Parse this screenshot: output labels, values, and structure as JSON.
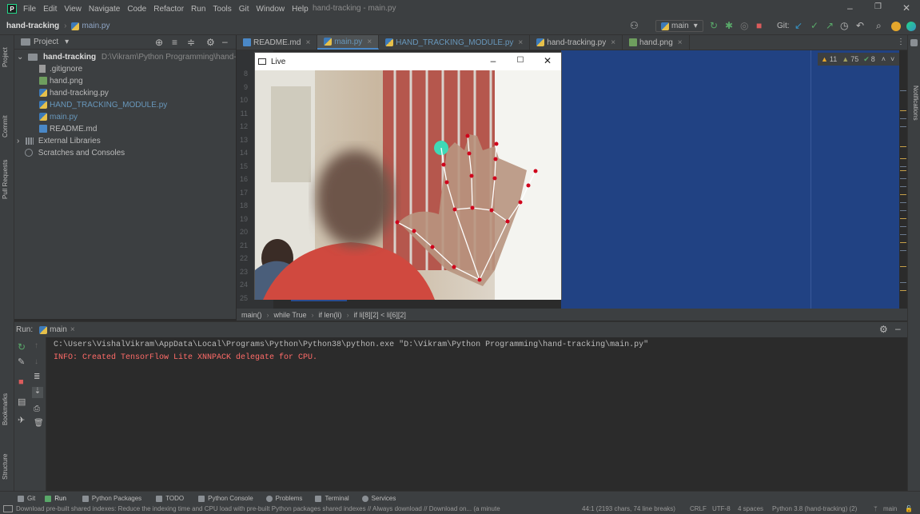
{
  "window": {
    "title": "hand-tracking - main.py"
  },
  "menu": [
    "File",
    "Edit",
    "View",
    "Navigate",
    "Code",
    "Refactor",
    "Run",
    "Tools",
    "Git",
    "Window",
    "Help"
  ],
  "navbar": {
    "project": "hand-tracking",
    "file": "main.py",
    "branch": "main",
    "git_label": "Git:"
  },
  "project_panel": {
    "title": "Project",
    "root": "hand-tracking",
    "root_path": "D:\\Vikram\\Python Programming\\hand-tracking",
    "files": [
      ".gitignore",
      "hand.png",
      "hand-tracking.py",
      "HAND_TRACKING_MODULE.py",
      "main.py",
      "README.md"
    ],
    "external": "External Libraries",
    "scratches": "Scratches and Consoles"
  },
  "side_tools": {
    "project": "Project",
    "commit": "Commit",
    "pull_requests": "Pull Requests",
    "bookmarks": "Bookmarks",
    "structure": "Structure",
    "notifications": "Notifications"
  },
  "tabs": [
    {
      "label": "README.md",
      "icon": "md"
    },
    {
      "label": "main.py",
      "icon": "py"
    },
    {
      "label": "HAND_TRACKING_MODULE.py",
      "icon": "py"
    },
    {
      "label": "hand-tracking.py",
      "icon": "py"
    },
    {
      "label": "hand.png",
      "icon": "png"
    }
  ],
  "line_numbers": [
    "8",
    "9",
    "10",
    "11",
    "12",
    "13",
    "14",
    "15",
    "16",
    "17",
    "18",
    "19",
    "20",
    "21",
    "22",
    "23",
    "24",
    "25"
  ],
  "inspections": {
    "warnings": "11",
    "weak": "75",
    "ok": "8"
  },
  "breadcrumbs": [
    "main()",
    "while True",
    "if len(li)",
    "if li[8][2] < li[6][2]"
  ],
  "run": {
    "label": "Run:",
    "config": "main"
  },
  "console": {
    "line1": "C:\\Users\\VishalVikram\\AppData\\Local\\Programs\\Python\\Python38\\python.exe \"D:\\Vikram\\Python Programming\\hand-tracking\\main.py\"",
    "line2": "INFO: Created TensorFlow Lite XNNPACK delegate for CPU."
  },
  "bottom_tools": [
    "Git",
    "Run",
    "Python Packages",
    "TODO",
    "Python Console",
    "Problems",
    "Terminal",
    "Services"
  ],
  "status": {
    "message": "Download pre-built shared indexes: Reduce the indexing time and CPU load with pre-built Python packages shared indexes // Always download // Download on... (a minute",
    "position": "44:1 (2193 chars, 74 line breaks)",
    "line_sep": "CRLF",
    "encoding": "UTF-8",
    "indent": "4 spaces",
    "interpreter": "Python 3.8 (hand-tracking) (2)",
    "branch": "main"
  },
  "live": {
    "title": "Live"
  },
  "colors": {
    "accent": "#4a88c7",
    "selection": "#214283",
    "error_text": "#ff6b68",
    "landmark": "#d0021b"
  }
}
